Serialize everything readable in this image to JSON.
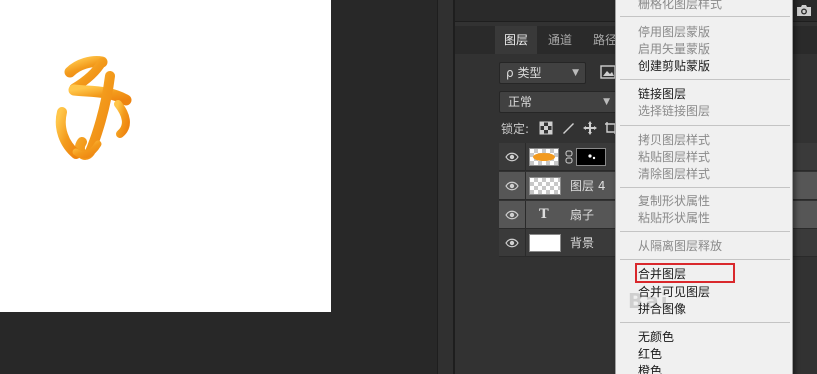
{
  "canvas": {
    "glyph_name": "orange-calligraphy-glyph",
    "glyph_colors": [
      "#f7a326",
      "#f08a12",
      "#ffd36a"
    ]
  },
  "tabs": [
    {
      "label": "图层",
      "active": true
    },
    {
      "label": "通道",
      "active": false
    },
    {
      "label": "路径",
      "active": false
    }
  ],
  "filter": {
    "kind_label": "类型",
    "search_icon": "ρ"
  },
  "blend": {
    "mode": "正常"
  },
  "lock": {
    "label": "锁定:"
  },
  "layers": [
    {
      "name": "",
      "thumb": "orange-shape",
      "selected": false,
      "has_mask": true
    },
    {
      "name": "图层 4",
      "thumb": "transparent",
      "selected": true
    },
    {
      "name": "扇子",
      "thumb": "text",
      "selected": true,
      "type_glyph": "T"
    },
    {
      "name": "背景",
      "thumb": "white",
      "selected": false
    }
  ],
  "context_menu": {
    "items": [
      {
        "label": "栅格化图层样式",
        "enabled": false
      },
      {
        "label": "停用图层蒙版",
        "enabled": false
      },
      {
        "label": "启用矢量蒙版",
        "enabled": false
      },
      {
        "label": "创建剪贴蒙版",
        "enabled": true
      },
      {
        "label": "链接图层",
        "enabled": true
      },
      {
        "label": "选择链接图层",
        "enabled": false
      },
      {
        "label": "拷贝图层样式",
        "enabled": false
      },
      {
        "label": "粘贴图层样式",
        "enabled": false
      },
      {
        "label": "清除图层样式",
        "enabled": false
      },
      {
        "label": "复制形状属性",
        "enabled": false
      },
      {
        "label": "粘贴形状属性",
        "enabled": false
      },
      {
        "label": "从隔离图层释放",
        "enabled": false
      },
      {
        "label": "合并图层",
        "enabled": true,
        "highlighted": true
      },
      {
        "label": "合并可见图层",
        "enabled": true
      },
      {
        "label": "拼合图像",
        "enabled": true
      },
      {
        "label": "无颜色",
        "enabled": true
      },
      {
        "label": "红色",
        "enabled": true
      },
      {
        "label": "橙色",
        "enabled": true
      }
    ],
    "highlight_color": "#d9282c"
  },
  "watermark": "Bai"
}
